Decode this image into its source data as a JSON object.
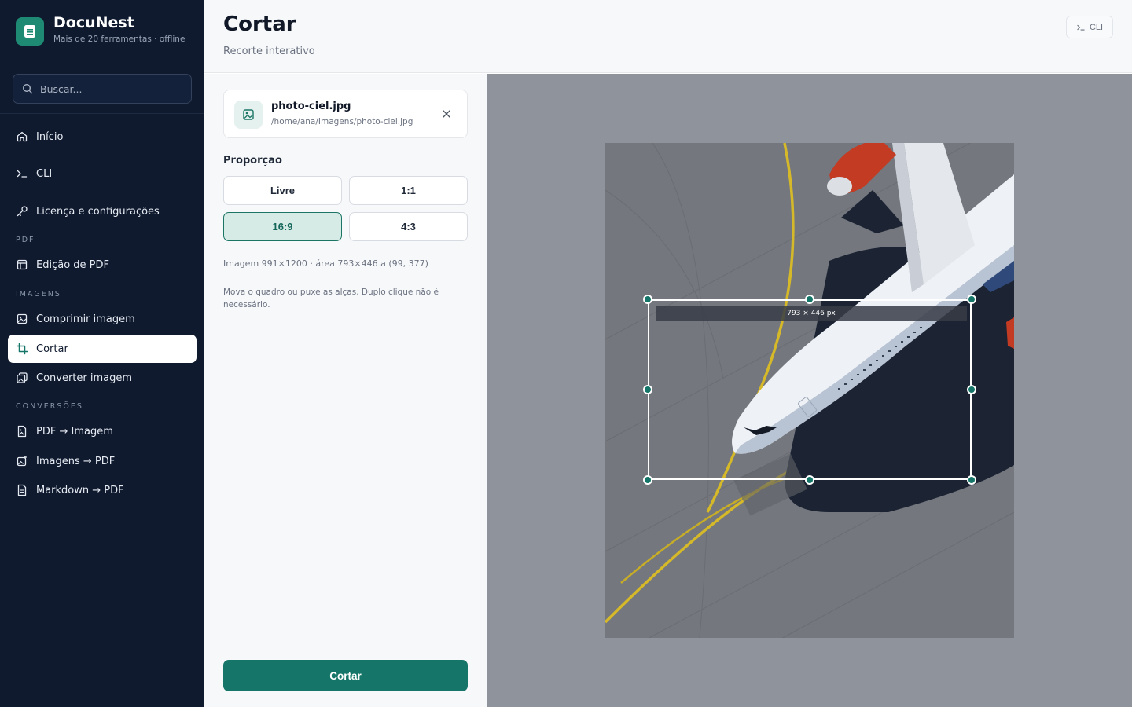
{
  "app": {
    "name": "DocuNest",
    "tagline": "Mais de 20 ferramentas · offline"
  },
  "search": {
    "placeholder": "Buscar..."
  },
  "nav": {
    "top": [
      {
        "label": "Início",
        "icon": "home-icon"
      },
      {
        "label": "CLI",
        "icon": "terminal-icon"
      },
      {
        "label": "Licença e configurações",
        "icon": "key-icon"
      }
    ],
    "sections": {
      "pdf": "PDF",
      "images": "IMAGENS",
      "conversions": "CONVERSÕES"
    },
    "pdf_items": [
      {
        "label": "Edição de PDF",
        "icon": "layout-icon"
      }
    ],
    "image_items": [
      {
        "label": "Comprimir imagem",
        "icon": "image-compress-icon"
      },
      {
        "label": "Cortar",
        "icon": "crop-icon",
        "active": true
      },
      {
        "label": "Converter imagem",
        "icon": "image-convert-icon"
      }
    ],
    "conversion_items": [
      {
        "label": "PDF → Imagem",
        "icon": "file-image-icon"
      },
      {
        "label": "Imagens → PDF",
        "icon": "images-icon"
      },
      {
        "label": "Markdown → PDF",
        "icon": "file-text-icon"
      }
    ]
  },
  "header": {
    "title": "Cortar",
    "subtitle": "Recorte interativo",
    "cli_label": "CLI"
  },
  "file": {
    "name": "photo-ciel.jpg",
    "path": "/home/ana/Imagens/photo-ciel.jpg"
  },
  "proportion": {
    "label": "Proporção",
    "options": [
      "Livre",
      "1:1",
      "16:9",
      "4:3"
    ],
    "selected": "16:9"
  },
  "info": "Imagem 991×1200 · área 793×446 a (99, 377)",
  "hint": "Mova o quadro ou puxe as alças. Duplo clique não é necessário.",
  "crop": {
    "size_label": "793 × 446 px",
    "action_label": "Cortar"
  },
  "colors": {
    "sidebar": "#0f1a2e",
    "accent": "#157568",
    "active_option_bg": "#d6ebe6",
    "preview_bg": "#8e939c"
  }
}
